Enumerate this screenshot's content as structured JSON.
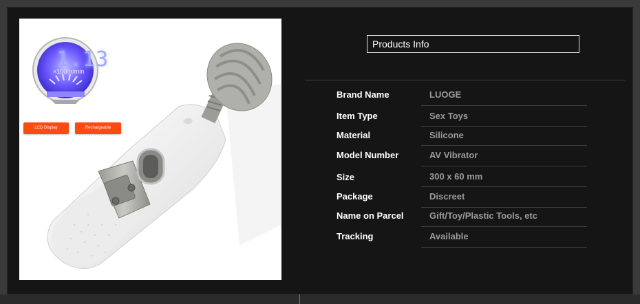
{
  "product_photo": {
    "lcd_value": "1.13",
    "lcd_unit": "×1000r/min",
    "badges": [
      "LCD Display",
      "Rechargeable"
    ]
  },
  "info": {
    "header": "Products Info",
    "rows": [
      {
        "label": "Brand Name",
        "value": "LUOGE"
      },
      {
        "label": "Item Type",
        "value": "Sex Toys"
      },
      {
        "label": "Material",
        "value": "Silicone"
      },
      {
        "label": "Model Number",
        "value": "AV Vibrator"
      },
      {
        "label": "Size",
        "value": "300 x 60 mm"
      },
      {
        "label": "Package",
        "value": "Discreet"
      },
      {
        "label": "Name on Parcel",
        "value": "Gift/Toy/Plastic Tools, etc"
      },
      {
        "label": "Tracking",
        "value": "Available"
      }
    ]
  },
  "colors": {
    "background": "#151515",
    "badge": "#ff4a14",
    "lcd": "#5b4cff",
    "label": "#ffffff",
    "value": "#9a9a9a"
  }
}
